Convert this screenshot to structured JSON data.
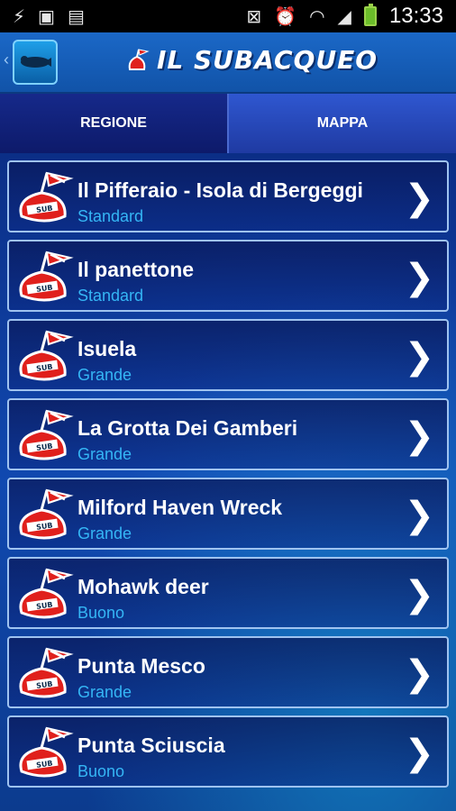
{
  "status_bar": {
    "time": "13:33",
    "left_icons": [
      "usb-icon",
      "image-icon",
      "briefcase-icon"
    ],
    "right_icons": [
      "nfc-off-icon",
      "alarm-icon",
      "wifi-icon",
      "signal-icon",
      "battery-charging-icon"
    ]
  },
  "header": {
    "title": "IL SUBACQUEO"
  },
  "tabs": [
    {
      "label": "REGIONE",
      "active": true
    },
    {
      "label": "MAPPA",
      "active": false
    }
  ],
  "items": [
    {
      "title": "Il Pifferaio - Isola di Bergeggi",
      "subtitle": "Standard"
    },
    {
      "title": "Il panettone",
      "subtitle": "Standard"
    },
    {
      "title": "Isuela",
      "subtitle": "Grande"
    },
    {
      "title": "La Grotta Dei Gamberi",
      "subtitle": "Grande"
    },
    {
      "title": "Milford Haven Wreck",
      "subtitle": "Grande"
    },
    {
      "title": "Mohawk deer",
      "subtitle": "Buono"
    },
    {
      "title": "Punta Mesco",
      "subtitle": "Grande"
    },
    {
      "title": "Punta Sciuscia",
      "subtitle": "Buono"
    }
  ],
  "colors": {
    "subtitle": "#35b6f5",
    "tab_active": "#13257a",
    "tab_inactive": "#2f57d0",
    "buoy_red": "#e0201c"
  },
  "buoy_label": "SUB"
}
